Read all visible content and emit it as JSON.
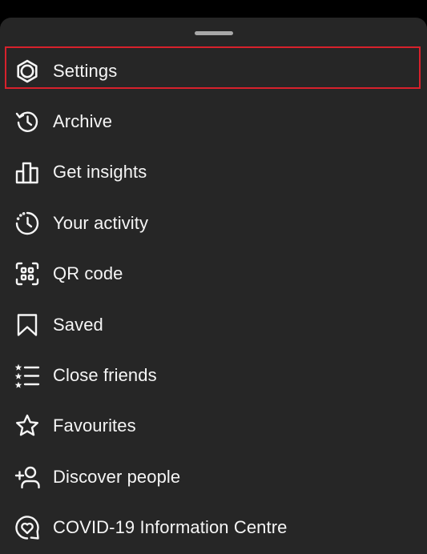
{
  "menu": {
    "items": [
      {
        "label": "Settings",
        "icon": "gear-icon"
      },
      {
        "label": "Archive",
        "icon": "archive-icon"
      },
      {
        "label": "Get insights",
        "icon": "bar-chart-icon"
      },
      {
        "label": "Your activity",
        "icon": "activity-icon"
      },
      {
        "label": "QR code",
        "icon": "qr-code-icon"
      },
      {
        "label": "Saved",
        "icon": "bookmark-icon"
      },
      {
        "label": "Close friends",
        "icon": "close-friends-icon"
      },
      {
        "label": "Favourites",
        "icon": "star-icon"
      },
      {
        "label": "Discover people",
        "icon": "add-person-icon"
      },
      {
        "label": "COVID-19 Information Centre",
        "icon": "covid-info-icon"
      }
    ]
  },
  "colors": {
    "sheet_background": "#262626",
    "text": "#f5f5f5",
    "highlight_border": "#d7212c",
    "handle": "#a8a8a8"
  }
}
